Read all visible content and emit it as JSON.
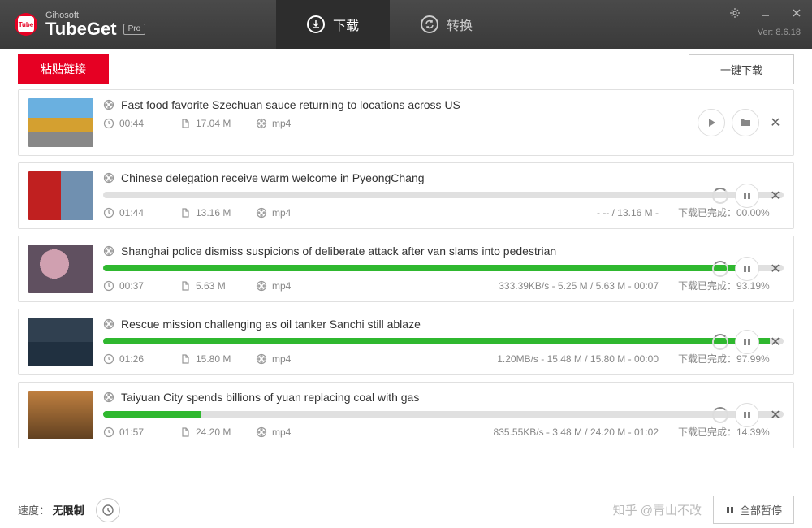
{
  "brand": {
    "company": "Gihosoft",
    "product": "TubeGet",
    "edition": "Pro"
  },
  "version": "Ver: 8.6.18",
  "tabs": {
    "download": "下载",
    "convert": "转换"
  },
  "toolbar": {
    "paste": "粘贴链接",
    "onekey": "一键下载"
  },
  "footer": {
    "speedLabel": "速度：",
    "speedValue": "无限制",
    "pauseAll": "全部暂停",
    "watermark": "知乎 @青山不改"
  },
  "items": [
    {
      "title": "Fast food favorite Szechuan sauce returning to locations across US",
      "duration": "00:44",
      "size": "17.04 M",
      "format": "mp4",
      "thumbClass": "t1",
      "completed": true
    },
    {
      "title": "Chinese delegation receive warm welcome in PyeongChang",
      "duration": "01:44",
      "size": "13.16 M",
      "format": "mp4",
      "thumbClass": "t2",
      "progress": 0,
      "info": "-  --  / 13.16 M -",
      "status": "下载已完成：00.00%"
    },
    {
      "title": "Shanghai police dismiss suspicions of deliberate attack after van slams into pedestrian",
      "duration": "00:37",
      "size": "5.63 M",
      "format": "mp4",
      "thumbClass": "t3",
      "progress": 93.19,
      "info": "333.39KB/s - 5.25 M / 5.63 M - 00:07",
      "status": "下载已完成：93.19%"
    },
    {
      "title": "Rescue mission challenging as oil tanker Sanchi still ablaze",
      "duration": "01:26",
      "size": "15.80 M",
      "format": "mp4",
      "thumbClass": "t4",
      "progress": 97.99,
      "info": "1.20MB/s - 15.48 M / 15.80 M - 00:00",
      "status": "下载已完成：97.99%"
    },
    {
      "title": "Taiyuan City spends billions of yuan replacing coal with gas",
      "duration": "01:57",
      "size": "24.20 M",
      "format": "mp4",
      "thumbClass": "t5",
      "progress": 14.39,
      "info": "835.55KB/s - 3.48 M / 24.20 M - 01:02",
      "status": "下载已完成：14.39%"
    }
  ]
}
